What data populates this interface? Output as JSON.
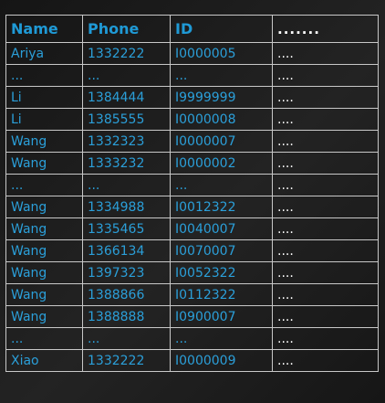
{
  "table": {
    "columns": [
      "Name",
      "Phone",
      "ID",
      "......."
    ],
    "rows": [
      [
        "Ariya",
        "1332222",
        "I0000005",
        "...."
      ],
      [
        "...",
        "...",
        "...",
        "...."
      ],
      [
        "Li",
        "1384444",
        "I9999999",
        "...."
      ],
      [
        "Li",
        "1385555",
        "I0000008",
        "...."
      ],
      [
        "Wang",
        "1332323",
        "I0000007",
        "...."
      ],
      [
        "Wang",
        "1333232",
        "I0000002",
        "...."
      ],
      [
        "...",
        "...",
        "...",
        "...."
      ],
      [
        "Wang",
        "1334988",
        "I0012322",
        "...."
      ],
      [
        "Wang",
        "1335465",
        "I0040007",
        "...."
      ],
      [
        "Wang",
        "1366134",
        "I0070007",
        "...."
      ],
      [
        "Wang",
        "1397323",
        "I0052322",
        "...."
      ],
      [
        "Wang",
        "1388866",
        "I0112322",
        "...."
      ],
      [
        "Wang",
        "1388888",
        "I0900007",
        "...."
      ],
      [
        "...",
        "...",
        "...",
        "...."
      ],
      [
        "Xiao",
        "1332222",
        "I0000009",
        "...."
      ]
    ]
  },
  "colors": {
    "header_text": "#1f9ad6",
    "cell_text": "#2b9fd9",
    "more_text": "#ffffff",
    "border": "#c8c8c8",
    "background": "#1b1b1b"
  }
}
